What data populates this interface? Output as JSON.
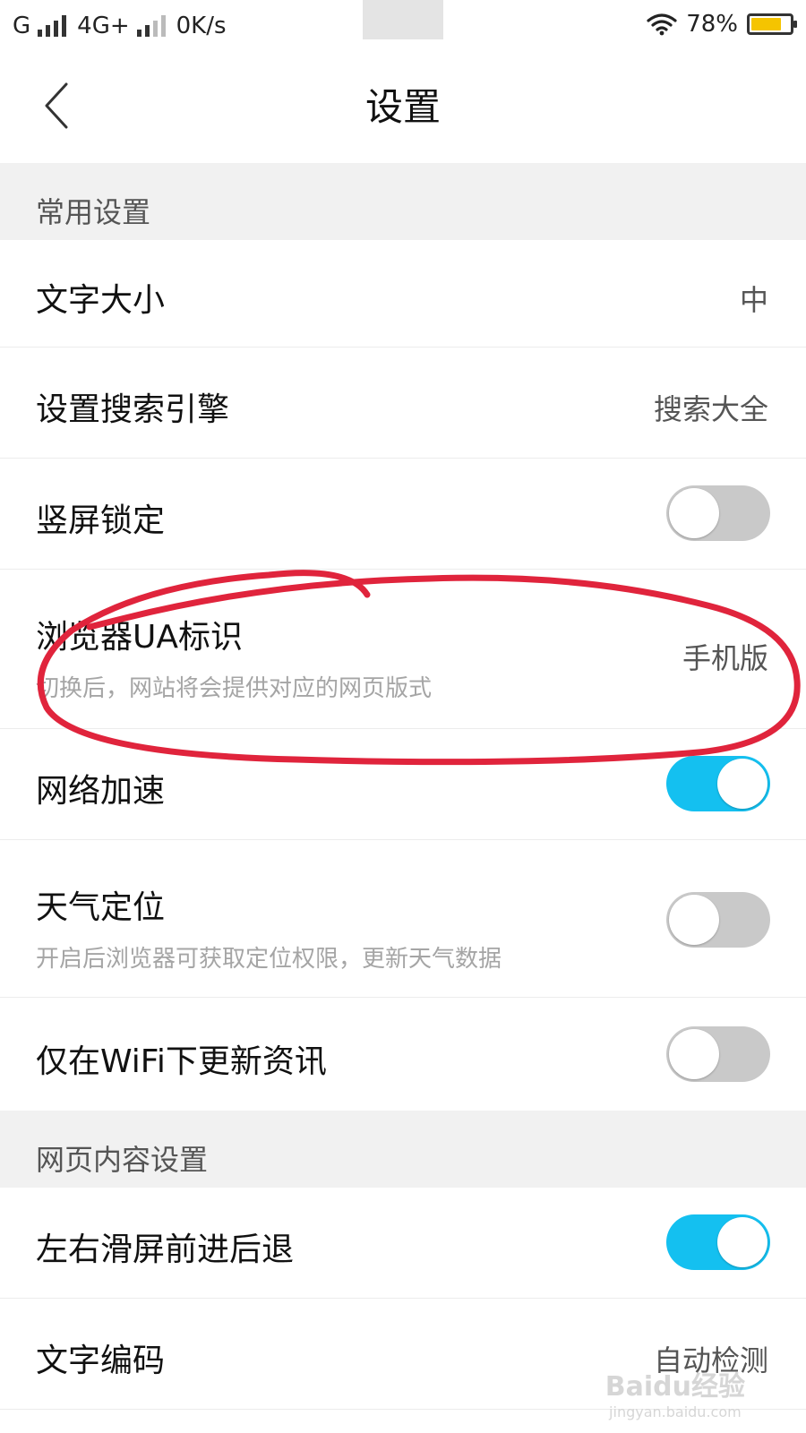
{
  "status_bar": {
    "carrier1": "G",
    "carrier2": "4G+",
    "speed": "0K/s",
    "battery_pct": "78%",
    "battery_level": 0.78,
    "icons": [
      "signal-icon",
      "wifi-icon",
      "battery-icon"
    ]
  },
  "header": {
    "title": "设置",
    "back_icon": "chevron-left-icon"
  },
  "sections": {
    "common": "常用设置",
    "web": "网页内容设置"
  },
  "items": {
    "font_size": {
      "label": "文字大小",
      "value": "中"
    },
    "search_engine": {
      "label": "设置搜索引擎",
      "value": "搜索大全"
    },
    "portrait_lock": {
      "label": "竖屏锁定",
      "on": false
    },
    "ua": {
      "label": "浏览器UA标识",
      "sub": "切换后，网站将会提供对应的网页版式",
      "value": "手机版"
    },
    "net_accel": {
      "label": "网络加速",
      "on": true
    },
    "weather_loc": {
      "label": "天气定位",
      "sub": "开启后浏览器可获取定位权限，更新天气数据",
      "on": false
    },
    "wifi_news": {
      "label": "仅在WiFi下更新资讯",
      "on": false
    },
    "swipe_nav": {
      "label": "左右滑屏前进后退",
      "on": true
    },
    "encoding": {
      "label": "文字编码",
      "value": "自动检测"
    }
  },
  "colors": {
    "toggle_on": "#14c0f0",
    "toggle_off": "#c9c9c9",
    "annotation": "#e0243c",
    "battery": "#f5c400"
  },
  "watermark": {
    "brand": "Baidu经验",
    "site": "jingyan.baidu.com"
  }
}
